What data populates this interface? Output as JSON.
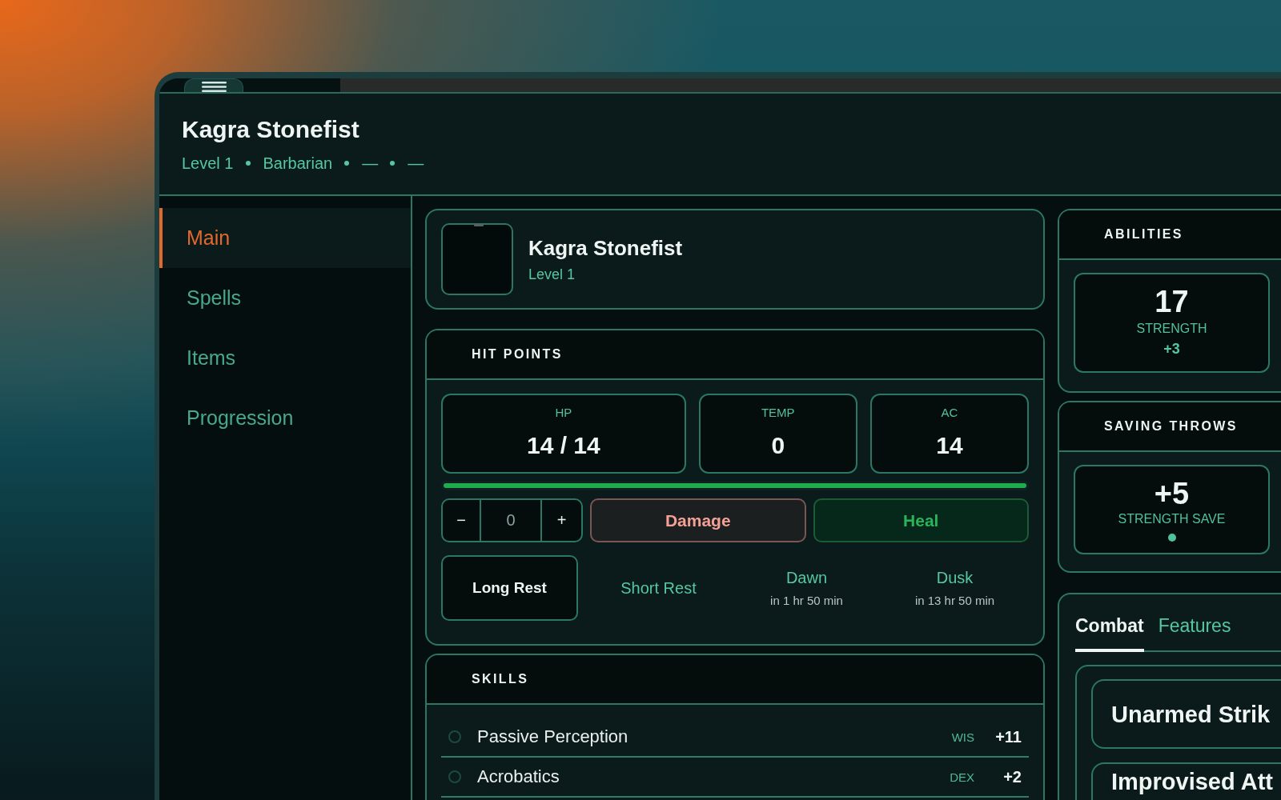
{
  "header": {
    "title": "Kagra Stonefist",
    "subtitle": [
      "Level 1",
      "Barbarian",
      "—",
      "—"
    ]
  },
  "sidebar": {
    "items": [
      {
        "label": "Main",
        "selected": true
      },
      {
        "label": "Spells",
        "selected": false
      },
      {
        "label": "Items",
        "selected": false
      },
      {
        "label": "Progression",
        "selected": false
      }
    ]
  },
  "profile": {
    "name": "Kagra Stonefist",
    "level": "Level 1"
  },
  "hit_points": {
    "title": "HIT POINTS",
    "stats": [
      {
        "label": "HP",
        "value": "14 / 14"
      },
      {
        "label": "TEMP",
        "value": "0"
      },
      {
        "label": "AC",
        "value": "14"
      }
    ],
    "level": 1,
    "stepper": {
      "decrement": "−",
      "value": "0",
      "increment": "+"
    },
    "actions": [
      {
        "kind": "damage",
        "label": "Damage"
      },
      {
        "kind": "heal",
        "label": "Heal"
      }
    ],
    "rests": [
      {
        "kind": "button",
        "label": "Long Rest"
      },
      {
        "kind": "link",
        "label": "Short Rest"
      },
      {
        "kind": "timer",
        "label": "Dawn",
        "note": "in 1 hr 50 min"
      },
      {
        "kind": "timer",
        "label": "Dusk",
        "note": "in 13 hr 50 min"
      }
    ]
  },
  "skills": {
    "title": "SKILLS",
    "rows": [
      {
        "name": "Passive Perception",
        "ability": "WIS",
        "bonus": "+11",
        "proficient": false
      },
      {
        "name": "Acrobatics",
        "ability": "DEX",
        "bonus": "+2",
        "proficient": false
      }
    ]
  },
  "abilities": {
    "title": "ABILITIES",
    "items": [
      {
        "score": "17",
        "name": "STRENGTH",
        "modifier": "+3"
      }
    ]
  },
  "saving_throws": {
    "title": "SAVING THROWS",
    "items": [
      {
        "value": "+5",
        "name": "STRENGTH SAVE",
        "proficient": true
      }
    ]
  },
  "combat": {
    "tabs": [
      {
        "label": "Combat",
        "selected": true
      },
      {
        "label": "Features",
        "selected": false
      }
    ],
    "attacks": [
      {
        "name": "Unarmed Strik"
      },
      {
        "name": "Improvised Att"
      }
    ]
  }
}
